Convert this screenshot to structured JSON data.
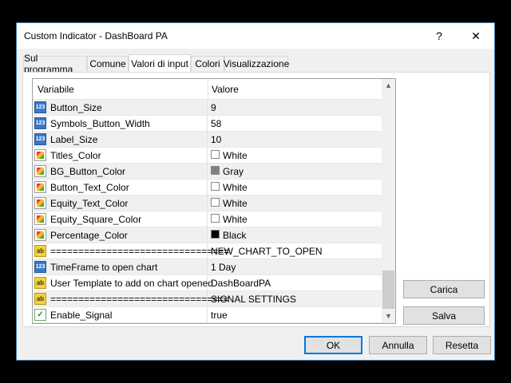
{
  "window": {
    "title": "Custom Indicator - DashBoard PA",
    "help": "?",
    "close": "✕"
  },
  "tabs": [
    {
      "label": "Sul programma"
    },
    {
      "label": "Comune"
    },
    {
      "label": "Valori di input",
      "active": true
    },
    {
      "label": "Colori"
    },
    {
      "label": "Visualizzazione"
    }
  ],
  "grid": {
    "col_variable": "Variabile",
    "col_value": "Valore",
    "rows": [
      {
        "icon": "number-type-icon",
        "name": "Button_Size",
        "value": "9"
      },
      {
        "icon": "number-type-icon",
        "name": "Symbols_Button_Width",
        "value": "58"
      },
      {
        "icon": "number-type-icon",
        "name": "Label_Size",
        "value": "10"
      },
      {
        "icon": "color-type-icon",
        "name": "Titles_Color",
        "value": "White",
        "swatch": "#ffffff"
      },
      {
        "icon": "color-type-icon",
        "name": "BG_Button_Color",
        "value": "Gray",
        "swatch": "#808080"
      },
      {
        "icon": "color-type-icon",
        "name": "Button_Text_Color",
        "value": "White",
        "swatch": "#ffffff"
      },
      {
        "icon": "color-type-icon",
        "name": "Equity_Text_Color",
        "value": "White",
        "swatch": "#ffffff"
      },
      {
        "icon": "color-type-icon",
        "name": "Equity_Square_Color",
        "value": "White",
        "swatch": "#ffffff"
      },
      {
        "icon": "color-type-icon",
        "name": "Percentage_Color",
        "value": "Black",
        "swatch": "#000000"
      },
      {
        "icon": "string-type-icon",
        "name": "================================",
        "value": "NEW_CHART_TO_OPEN"
      },
      {
        "icon": "number-type-icon",
        "name": "TimeFrame to open chart",
        "value": "1 Day"
      },
      {
        "icon": "string-type-icon",
        "name": "User Template to add on chart opened",
        "value": "DashBoardPA"
      },
      {
        "icon": "string-type-icon",
        "name": "================================",
        "value": "SIGNAL SETTINGS"
      },
      {
        "icon": "bool-type-icon",
        "name": "Enable_Signal",
        "value": "true"
      }
    ]
  },
  "side_buttons": {
    "load": "Carica",
    "save": "Salva"
  },
  "footer_buttons": {
    "ok": "OK",
    "cancel": "Annulla",
    "reset": "Resetta"
  },
  "icon_glyphs": {
    "number": "123",
    "string": "ab",
    "bool": "✓"
  },
  "colors": {
    "accent": "#0078d7",
    "row_alt": "#f0f0f0"
  }
}
